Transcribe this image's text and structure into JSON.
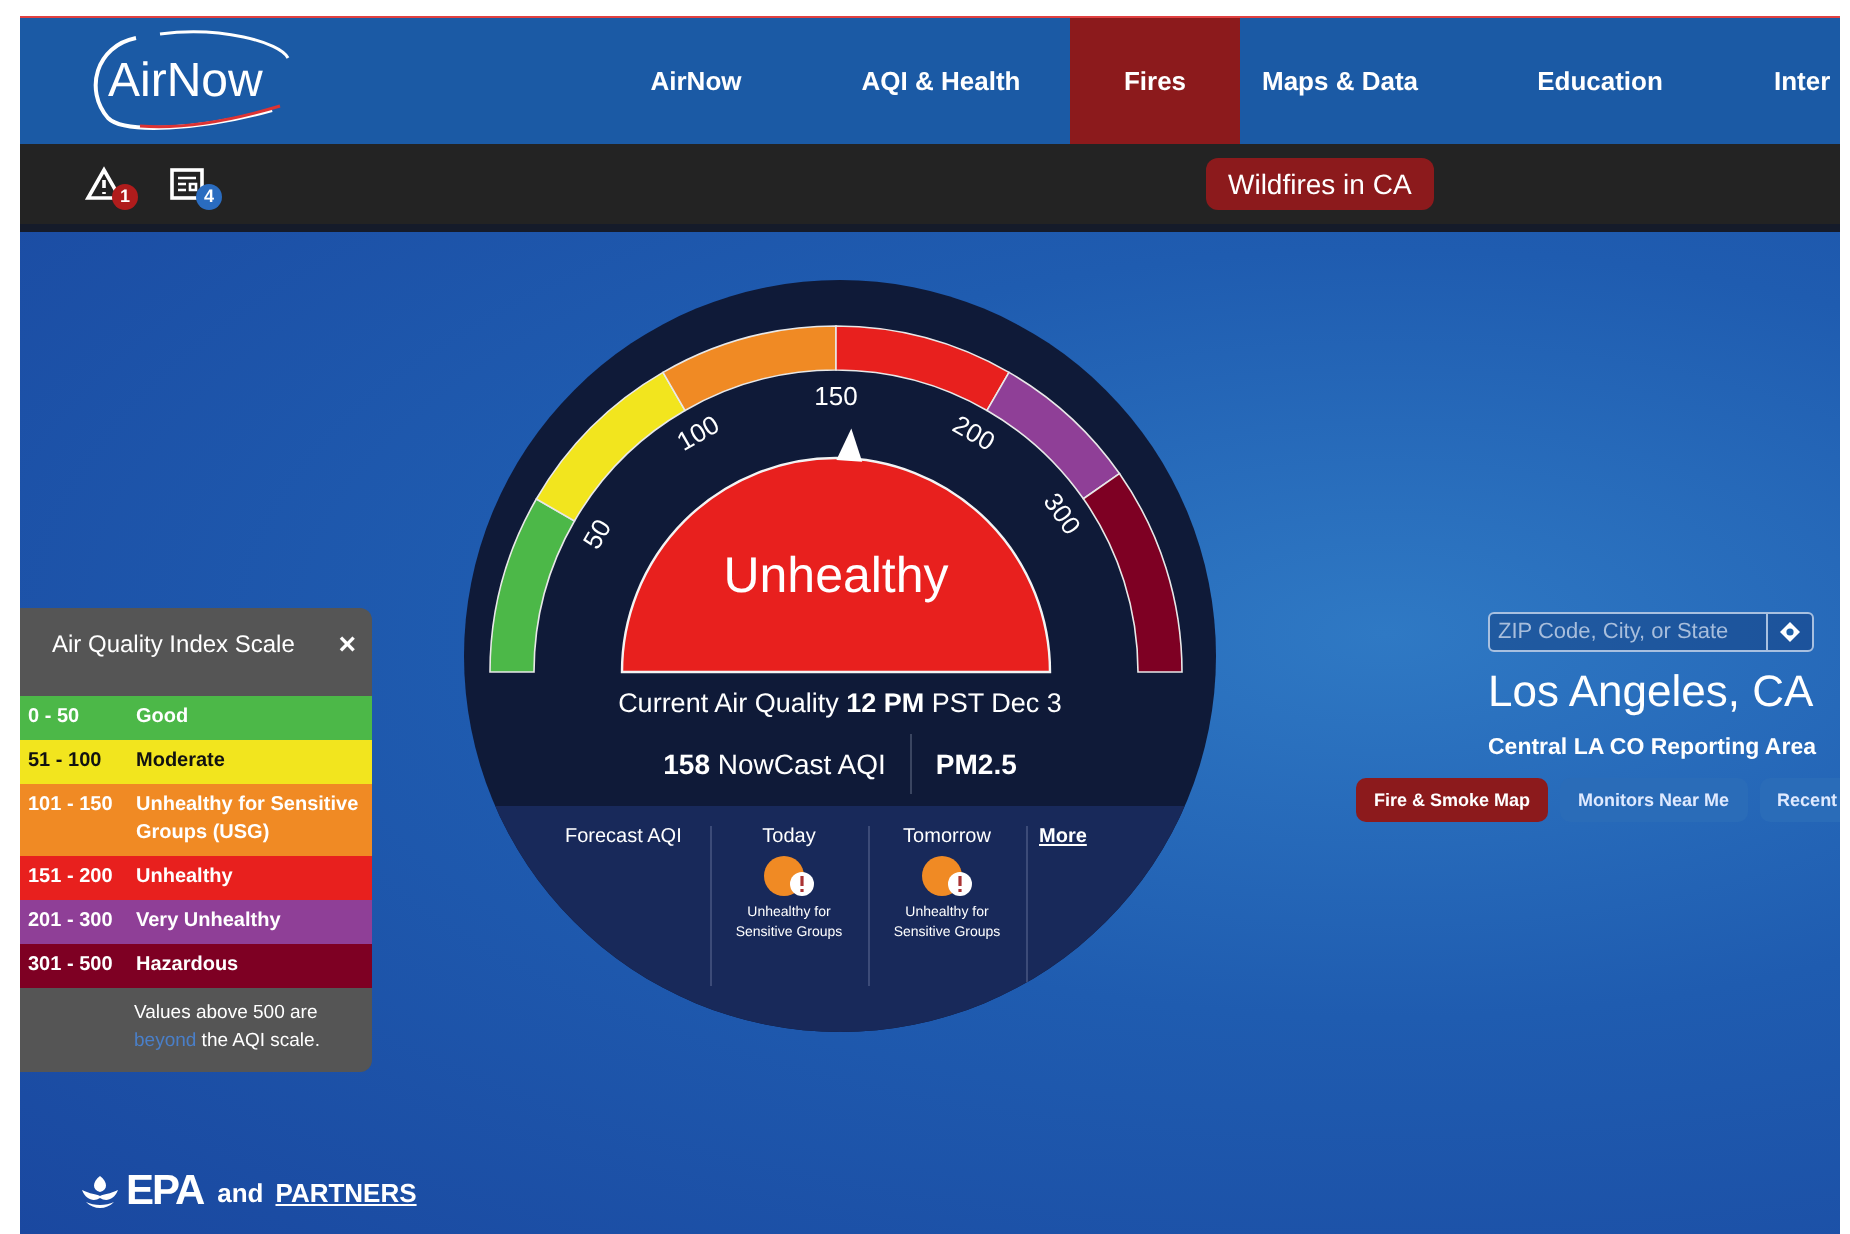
{
  "header": {
    "logo": "AirNow",
    "nav": [
      {
        "label": "AirNow",
        "selected": false
      },
      {
        "label": "AQI & Health",
        "selected": false
      },
      {
        "label": "Fires",
        "selected": true
      },
      {
        "label": "Maps & Data",
        "selected": false
      },
      {
        "label": "Education",
        "selected": false
      },
      {
        "label": "Inter",
        "selected": false
      }
    ]
  },
  "alerts_bar": {
    "badges": [
      {
        "kind": "alert",
        "count": "1"
      },
      {
        "kind": "news",
        "count": "4"
      }
    ],
    "banner": "Wildfires in CA"
  },
  "gauge": {
    "segments": [
      {
        "color": "#4cb848"
      },
      {
        "color": "#f2e51e"
      },
      {
        "color": "#f08a24"
      },
      {
        "color": "#e8201e"
      },
      {
        "color": "#8f3f97"
      },
      {
        "color": "#7e0023"
      }
    ],
    "ticks": [
      "50",
      "100",
      "150",
      "200",
      "300"
    ],
    "level": 0.52,
    "category": "Unhealthy",
    "current": "Current Air Quality **12 PM** PST Dec 3",
    "reading": "**158** NowCast AQI",
    "pollutant": "PM2.5",
    "forecast": {
      "label": "Forecast AQI",
      "days": [
        {
          "day": "Today",
          "category": "Unhealthy for Sensitive Groups",
          "color": "#f08a24"
        },
        {
          "day": "Tomorrow",
          "category": "Unhealthy for Sensitive Groups",
          "color": "#f08a24"
        }
      ],
      "more": "More"
    }
  },
  "aqi_scale": {
    "title": "Air Quality Index Scale",
    "close": "×",
    "rows": [
      {
        "range": "0 - 50",
        "category": "Good",
        "color": "#4cb848"
      },
      {
        "range": "51 - 100",
        "category": "Moderate",
        "color": "#f2e51e"
      },
      {
        "range": "101 - 150",
        "category": "Unhealthy for Sensitive Groups (USG)",
        "color": "#f08a24"
      },
      {
        "range": "151 - 200",
        "category": "Unhealthy",
        "color": "#e8201e"
      },
      {
        "range": "201 - 300",
        "category": "Very Unhealthy",
        "color": "#8f3f97"
      },
      {
        "range": "301 - 500",
        "category": "Hazardous",
        "color": "#7e0023"
      }
    ],
    "note": {
      "before": "Values above 500 are",
      "link": "beyond",
      "after": "the AQI scale."
    }
  },
  "location": {
    "search_placeholder": "ZIP Code, City, or State",
    "city": "Los Angeles, CA",
    "area": "Central LA CO Reporting Area",
    "buttons": [
      {
        "label": "Fire & Smoke Map",
        "selected": true
      },
      {
        "label": "Monitors Near Me",
        "selected": false
      },
      {
        "label": "Recent",
        "selected": false
      }
    ]
  },
  "footer": {
    "logo": "EPA",
    "and": "and",
    "partners": "PARTNERS"
  }
}
